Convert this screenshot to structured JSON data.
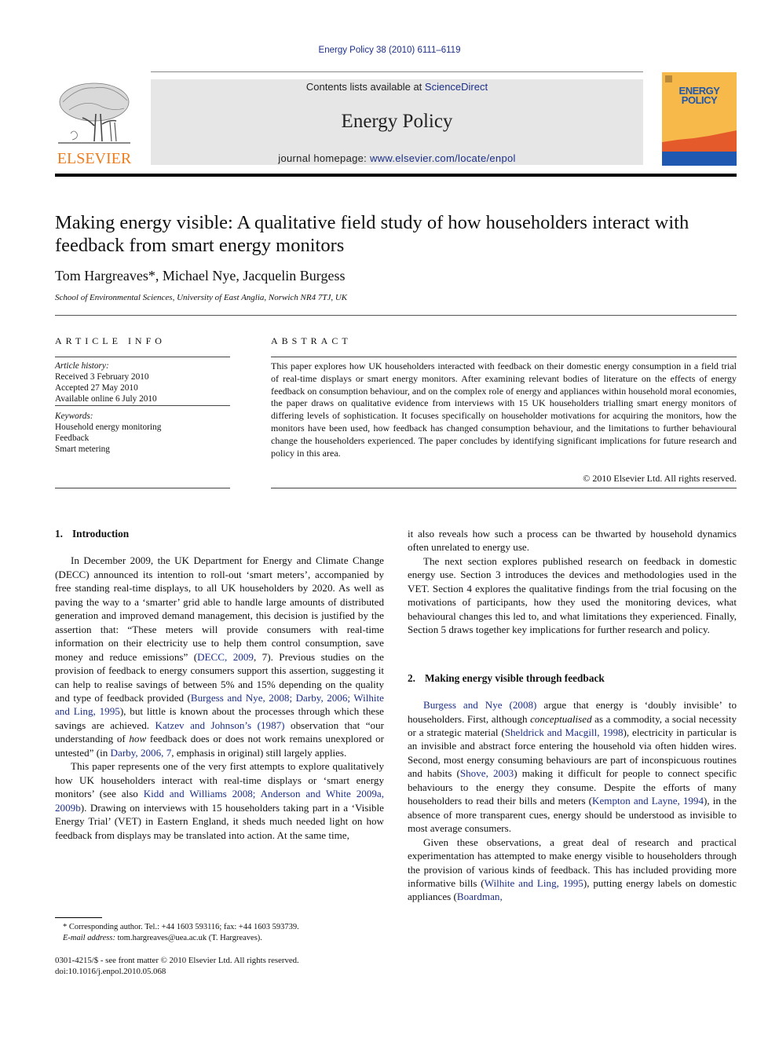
{
  "header": {
    "citation": "Energy Policy 38 (2010) 6111–6119",
    "contents_prefix": "Contents lists available at ",
    "contents_link": "ScienceDirect",
    "journal_name": "Energy Policy",
    "homepage_prefix": "journal homepage: ",
    "homepage_link": "www.elsevier.com/locate/enpol",
    "publisher_logo_text": "ELSEVIER",
    "cover_title_line1": "ENERGY",
    "cover_title_line2": "POLICY"
  },
  "colors": {
    "link": "#1c2f86",
    "elsevier_orange": "#ee7d1f",
    "cover_yellow": "#f6b94a",
    "cover_red": "#e55a2b",
    "cover_blue": "#1f58b0"
  },
  "article": {
    "title": "Making energy visible: A qualitative field study of how householders interact with feedback from smart energy monitors",
    "authors": "Tom Hargreaves*, Michael Nye, Jacquelin Burgess",
    "affiliation": "School of Environmental Sciences, University of East Anglia, Norwich NR4 7TJ, UK"
  },
  "article_info": {
    "heading": "ARTICLE INFO",
    "history_label": "Article history:",
    "received": "Received 3 February 2010",
    "accepted": "Accepted 27 May 2010",
    "online": "Available online 6 July 2010",
    "keywords_label": "Keywords:",
    "keywords": [
      "Household energy monitoring",
      "Feedback",
      "Smart metering"
    ]
  },
  "abstract": {
    "heading": "ABSTRACT",
    "text": "This paper explores how UK householders interacted with feedback on their domestic energy consumption in a field trial of real-time displays or smart energy monitors. After examining relevant bodies of literature on the effects of energy feedback on consumption behaviour, and on the complex role of energy and appliances within household moral economies, the paper draws on qualitative evidence from interviews with 15 UK householders trialling smart energy monitors of differing levels of sophistication. It focuses specifically on householder motivations for acquiring the monitors, how the monitors have been used, how feedback has changed consumption behaviour, and the limitations to further behavioural change the householders experienced. The paper concludes by identifying significant implications for future research and policy in this area.",
    "copyright": "© 2010 Elsevier Ltd. All rights reserved."
  },
  "body": {
    "s1_number": "1.",
    "s1_title": "Introduction",
    "p1_a": "In December 2009, the UK Department for Energy and Climate Change (DECC) announced its intention to roll-out ‘smart meters’, accompanied by free standing real-time displays, to all UK householders by 2020. As well as paving the way to a ‘smarter’ grid able to handle large amounts of distributed generation and improved demand management, this decision is justified by the assertion that: “These meters will provide consumers with real-time information on their electricity use to help them control consumption, save money and reduce emissions” (",
    "p1_link1": "DECC, 2009",
    "p1_b": ", 7). Previous studies on the provision of feedback to energy consumers support this assertion, suggesting it can help to realise savings of between 5% and 15% depending on the quality and type of feedback provided (",
    "p1_link2": "Burgess and Nye, 2008; Darby, 2006; Wilhite and Ling, 1995",
    "p1_c": "), but little is known about the processes through which these savings are achieved. ",
    "p1_link3": "Katzev and Johnson’s (1987)",
    "p1_d": " observation that “our understanding of ",
    "p1_em": "how",
    "p1_e": " feedback does or does not work remains unexplored or untested” (in ",
    "p1_link4": "Darby, 2006, 7",
    "p1_f": ", emphasis in original) still largely applies.",
    "p2_a": "This paper represents one of the very first attempts to explore qualitatively how UK householders interact with real-time displays or ‘smart energy monitors’ (see also ",
    "p2_link1": "Kidd and Williams 2008; Anderson and White 2009a, 2009b",
    "p2_b": "). Drawing on interviews with 15 householders taking part in a ‘Visible Energy Trial’ (VET) in Eastern England, it sheds much needed light on how feedback from displays may be translated into action. At the same time,",
    "r_p1": "it also reveals how such a process can be thwarted by household dynamics often unrelated to energy use.",
    "r_p2": "The next section explores published research on feedback in domestic energy use. Section 3 introduces the devices and methodologies used in the VET. Section 4 explores the qualitative findings from the trial focusing on the motivations of participants, how they used the monitoring devices, what behavioural changes this led to, and what limitations they experienced. Finally, Section 5 draws together key implications for further research and policy.",
    "s2_number": "2.",
    "s2_title": "Making energy visible through feedback",
    "r_p3_link1": "Burgess and Nye (2008)",
    "r_p3_a": " argue that energy is ‘doubly invisible’ to householders. First, although ",
    "r_p3_em": "conceptualised",
    "r_p3_b": " as a commodity, a social necessity or a strategic material (",
    "r_p3_link2": "Sheldrick and Macgill, 1998",
    "r_p3_c": "), electricity in particular is an invisible and abstract force entering the household via often hidden wires. Second, most energy consuming behaviours are part of inconspicuous routines and habits (",
    "r_p3_link3": "Shove, 2003",
    "r_p3_d": ") making it difficult for people to connect specific behaviours to the energy they consume. Despite the efforts of many householders to read their bills and meters (",
    "r_p3_link4": "Kempton and Layne, 1994",
    "r_p3_e": "), in the absence of more transparent cues, energy should be understood as invisible to most average consumers.",
    "r_p4_a": "Given these observations, a great deal of research and practical experimentation has attempted to make energy visible to householders through the provision of various kinds of feedback. This has included providing more informative bills (",
    "r_p4_link1": "Wilhite and Ling, 1995",
    "r_p4_b": "), putting energy labels on domestic appliances (",
    "r_p4_link2": "Boardman,"
  },
  "footnote": {
    "corresponding": "* Corresponding author. Tel.: +44 1603 593116; fax: +44 1603 593739.",
    "email_label": "E-mail address:",
    "email": " tom.hargreaves@uea.ac.uk (T. Hargreaves)."
  },
  "front_matter": {
    "issn_line": "0301-4215/$ - see front matter © 2010 Elsevier Ltd. All rights reserved.",
    "doi": "doi:10.1016/j.enpol.2010.05.068"
  }
}
